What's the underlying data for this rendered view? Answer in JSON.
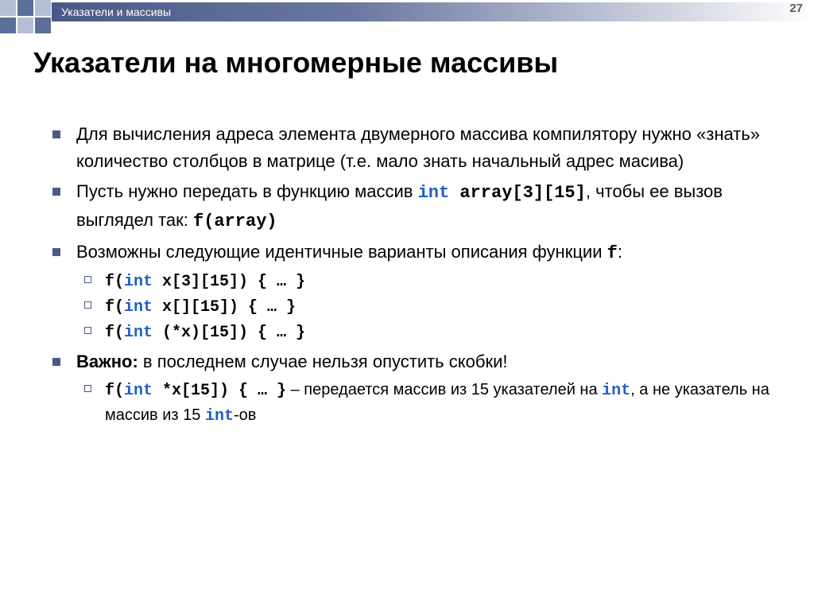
{
  "header": {
    "breadcrumb": "Указатели и массивы",
    "page_number": "27"
  },
  "title": "Указатели на многомерные массивы",
  "bullets": {
    "b1": "Для вычисления адреса элемента двумерного массива компилятору нужно «знать» количество столбцов в матрице (т.е. мало знать начальный адрес масива)",
    "b2_pre": "Пусть нужно передать в функцию массив ",
    "b2_code_kw": "int",
    "b2_code_rest": " array[3][15]",
    "b2_mid": ", чтобы ее вызов выглядел так: ",
    "b2_code2": "f(array)",
    "b3_pre": "Возможны следующие идентичные  варианты описания функции ",
    "b3_code": "f",
    "b3_post": ":",
    "s1_a": "f(",
    "s1_kw": "int",
    "s1_b": " x[3][15]) { … }",
    "s2_a": "f(",
    "s2_kw": "int",
    "s2_b": " x[][15]) { … }",
    "s3_a": "f(",
    "s3_kw": "int",
    "s3_b": " (*x)[15]) { … }",
    "b4_bold": "Важно:",
    "b4_rest": " в последнем случае нельзя опустить скобки!",
    "s4_a": "f(",
    "s4_kw": "int",
    "s4_b": " *x[15]) { … }",
    "s4_text1": " – передается массив из 15 указателей на ",
    "s4_kw2": "int",
    "s4_text2": ", а не указатель на массив из 15 ",
    "s4_kw3": "int",
    "s4_text3": "-ов"
  }
}
